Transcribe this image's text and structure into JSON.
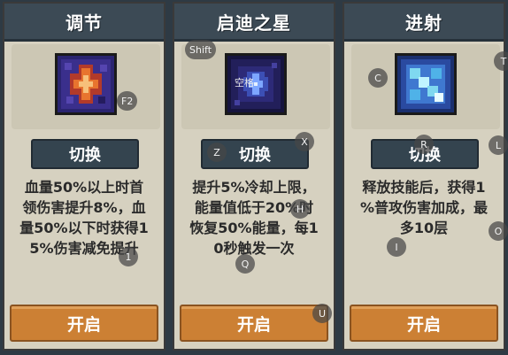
{
  "colors": {
    "header_bg": "#3c4a55",
    "card_bg": "#d6d1c0",
    "switch_bg": "#34444f",
    "open_bg": "#cc8034",
    "desc_text": "#2a2a2a"
  },
  "cards": [
    {
      "title": "调节",
      "icon": "red-cross-skill-icon",
      "switch_label": "切换",
      "description": "血量50%以上时首\n领伤害提升8%，血\n量50%以下时获得1\n5%伤害减免提升",
      "open_label": "开启"
    },
    {
      "title": "启迪之星",
      "icon": "blue-star-skill-icon",
      "icon_text": "空格",
      "switch_label": "切换",
      "description": "提升5%冷却上限，\n能量值低于20%时\n恢复50%能量，每1\n0秒触发一次",
      "open_label": "开启"
    },
    {
      "title": "进射",
      "icon": "cyan-arrow-skill-icon",
      "switch_label": "切换",
      "description": "释放技能后，获得1\n%普攻伤害加成，最\n多10层",
      "open_label": "开启"
    }
  ],
  "key_hints": [
    "F2",
    "Shift",
    "Z",
    "X",
    "H",
    "Q",
    "U",
    "C",
    "T",
    "R",
    "L",
    "I",
    "O",
    "1"
  ]
}
